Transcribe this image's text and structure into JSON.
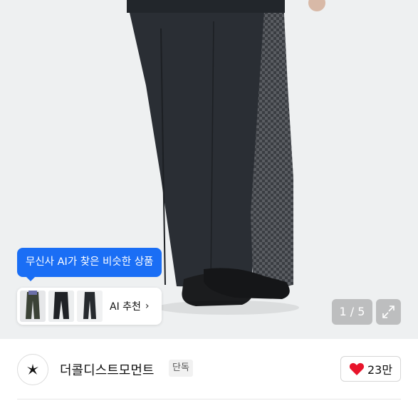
{
  "ai_tooltip": {
    "text": "무신사 AI가 찾은 비슷한 상품"
  },
  "ai_card": {
    "label": "AI 추천",
    "chevron": "›",
    "thumbnails": [
      "pants-thumb-1",
      "pants-thumb-2",
      "pants-thumb-3"
    ]
  },
  "pager": {
    "current": 1,
    "total": 5,
    "text": "1 / 5"
  },
  "expand": {
    "icon": "expand-icon"
  },
  "brand": {
    "name": "더콜디스트모먼트",
    "badge": "단독",
    "logo_icon": "star-logo-icon"
  },
  "like": {
    "count": "23만",
    "icon": "heart-icon",
    "color": "#e8142b"
  },
  "colors": {
    "accent": "#1a6ef5",
    "heart": "#e8142b"
  }
}
